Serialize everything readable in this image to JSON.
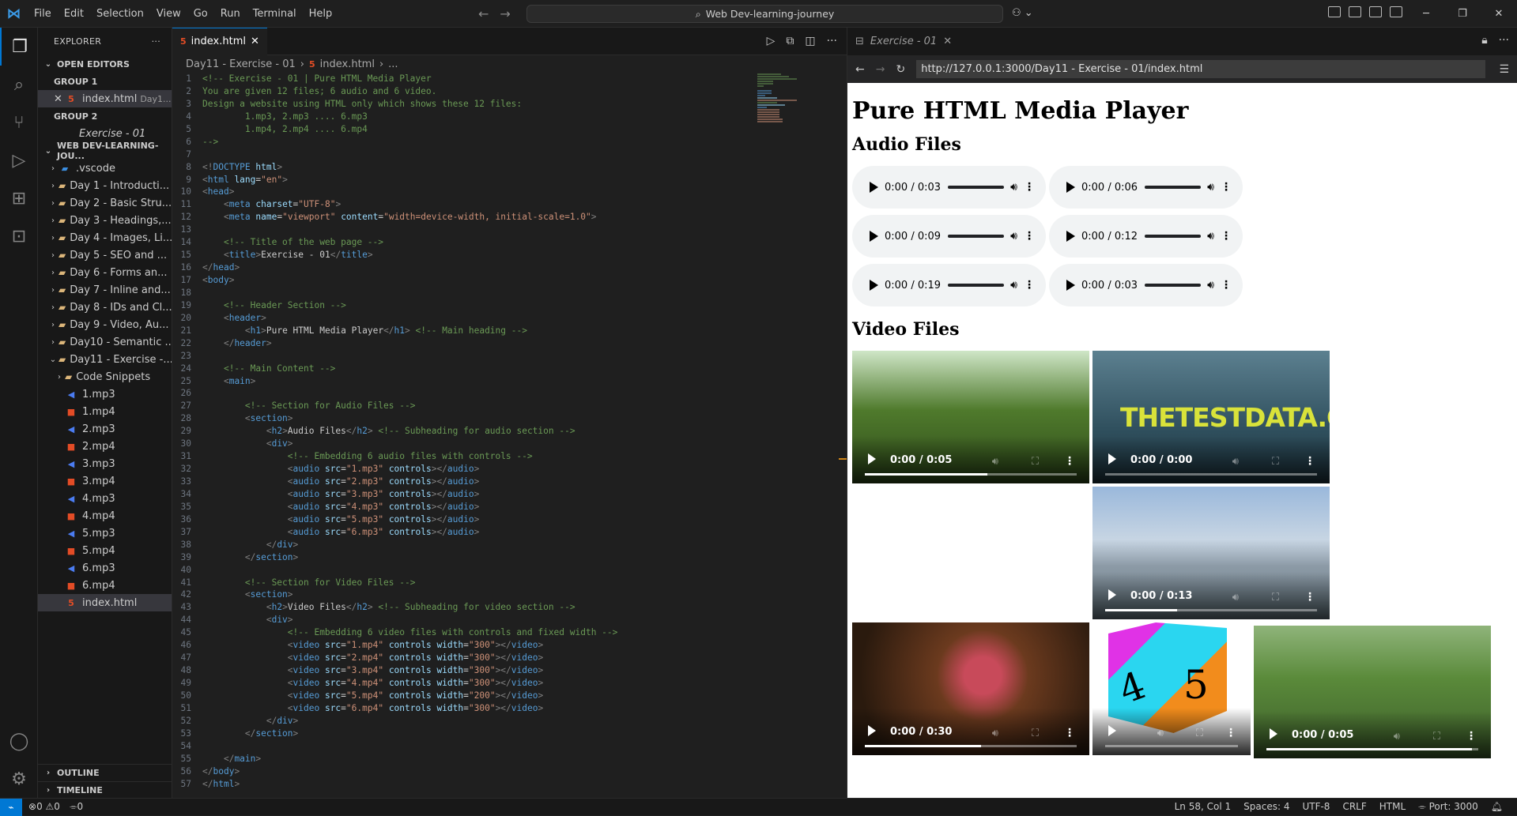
{
  "menu": [
    "File",
    "Edit",
    "Selection",
    "View",
    "Go",
    "Run",
    "Terminal",
    "Help"
  ],
  "command_center": "Web Dev-learning-journey",
  "sidebar": {
    "title": "EXPLORER",
    "open_editors": "OPEN EDITORS",
    "group1": "GROUP 1",
    "group1_file": "index.html",
    "group1_desc": "Day1...",
    "group2": "GROUP 2",
    "group2_file": "Exercise - 01",
    "workspace": "WEB DEV-LEARNING-JOU...",
    "folders": [
      ".vscode",
      "Day 1 - Introducti...",
      "Day 2 - Basic Stru...",
      "Day 3 - Headings,...",
      "Day 4 - Images, Li...",
      "Day 5 - SEO and ...",
      "Day 6 - Forms an...",
      "Day 7 - Inline and...",
      "Day 8 - IDs and Cl...",
      "Day 9 - Video, Au...",
      "Day10 - Semantic ...",
      "Day11 - Exercise -..."
    ],
    "subfolder": "Code Snippets",
    "files": [
      "1.mp3",
      "1.mp4",
      "2.mp3",
      "2.mp4",
      "3.mp3",
      "3.mp4",
      "4.mp3",
      "4.mp4",
      "5.mp3",
      "5.mp4",
      "6.mp3",
      "6.mp4",
      "index.html"
    ],
    "outline": "OUTLINE",
    "timeline": "TIMELINE"
  },
  "editor": {
    "tab": "index.html",
    "crumb1": "Day11 - Exercise - 01",
    "crumb2": "index.html",
    "crumb3": "..."
  },
  "browser": {
    "tab": "Exercise - 01",
    "url": "http://127.0.0.1:3000/Day11 - Exercise - 01/index.html",
    "h1": "Pure HTML Media Player",
    "audio_heading": "Audio Files",
    "video_heading": "Video Files",
    "audios": [
      {
        "time": "0:00 / 0:03"
      },
      {
        "time": "0:00 / 0:06"
      },
      {
        "time": "0:00 / 0:09"
      },
      {
        "time": "0:00 / 0:12"
      },
      {
        "time": "0:00 / 0:19"
      },
      {
        "time": "0:00 / 0:03"
      }
    ],
    "videos": [
      {
        "time": "0:00 / 0:05"
      },
      {
        "time": "0:00 / 0:00",
        "watermark": "THETESTDATA.COM"
      },
      {
        "time": "0:00 / 0:13"
      },
      {
        "time": "0:00 / 0:30"
      },
      {
        "time": ""
      },
      {
        "time": "0:00 / 0:05"
      }
    ]
  },
  "status": {
    "errors": "0",
    "warnings": "0",
    "ports_count": "0",
    "position": "Ln 58, Col 1",
    "spaces": "Spaces: 4",
    "encoding": "UTF-8",
    "eol": "CRLF",
    "language": "HTML",
    "port": "Port: 3000"
  },
  "code_lines": [
    [
      [
        "c",
        "<!-- Exercise - 01 | Pure HTML Media Player"
      ]
    ],
    [
      [
        "c",
        "You are given 12 files; 6 audio and 6 video."
      ]
    ],
    [
      [
        "c",
        "Design a website using HTML only which shows these 12 files:"
      ]
    ],
    [
      [
        "c",
        "        1.mp3, 2.mp3 .... 6.mp3"
      ]
    ],
    [
      [
        "c",
        "        1.mp4, 2.mp4 .... 6.mp4"
      ]
    ],
    [
      [
        "c",
        "-->"
      ]
    ],
    [],
    [
      [
        "p",
        "<!"
      ],
      [
        "t",
        "DOCTYPE"
      ],
      [
        "a",
        " html"
      ],
      [
        "p",
        ">"
      ]
    ],
    [
      [
        "p",
        "<"
      ],
      [
        "t",
        "html"
      ],
      [
        "a",
        " lang"
      ],
      [
        "ltxt",
        "="
      ],
      [
        "s",
        "\"en\""
      ],
      [
        "p",
        ">"
      ]
    ],
    [
      [
        "p",
        "<"
      ],
      [
        "t",
        "head"
      ],
      [
        "p",
        ">"
      ]
    ],
    [
      [
        "ltxt",
        "    "
      ],
      [
        "p",
        "<"
      ],
      [
        "t",
        "meta"
      ],
      [
        "a",
        " charset"
      ],
      [
        "ltxt",
        "="
      ],
      [
        "s",
        "\"UTF-8\""
      ],
      [
        "p",
        ">"
      ]
    ],
    [
      [
        "ltxt",
        "    "
      ],
      [
        "p",
        "<"
      ],
      [
        "t",
        "meta"
      ],
      [
        "a",
        " name"
      ],
      [
        "ltxt",
        "="
      ],
      [
        "s",
        "\"viewport\""
      ],
      [
        "a",
        " content"
      ],
      [
        "ltxt",
        "="
      ],
      [
        "s",
        "\"width=device-width, initial-scale=1.0\""
      ],
      [
        "p",
        ">"
      ]
    ],
    [],
    [
      [
        "ltxt",
        "    "
      ],
      [
        "c",
        "<!-- Title of the web page -->"
      ]
    ],
    [
      [
        "ltxt",
        "    "
      ],
      [
        "p",
        "<"
      ],
      [
        "t",
        "title"
      ],
      [
        "p",
        ">"
      ],
      [
        "ltxt",
        "Exercise - 01"
      ],
      [
        "p",
        "</"
      ],
      [
        "t",
        "title"
      ],
      [
        "p",
        ">"
      ]
    ],
    [
      [
        "p",
        "</"
      ],
      [
        "t",
        "head"
      ],
      [
        "p",
        ">"
      ]
    ],
    [
      [
        "p",
        "<"
      ],
      [
        "t",
        "body"
      ],
      [
        "p",
        ">"
      ]
    ],
    [],
    [
      [
        "ltxt",
        "    "
      ],
      [
        "c",
        "<!-- Header Section -->"
      ]
    ],
    [
      [
        "ltxt",
        "    "
      ],
      [
        "p",
        "<"
      ],
      [
        "t",
        "header"
      ],
      [
        "p",
        ">"
      ]
    ],
    [
      [
        "ltxt",
        "        "
      ],
      [
        "p",
        "<"
      ],
      [
        "t",
        "h1"
      ],
      [
        "p",
        ">"
      ],
      [
        "ltxt",
        "Pure HTML Media Player"
      ],
      [
        "p",
        "</"
      ],
      [
        "t",
        "h1"
      ],
      [
        "p",
        "> "
      ],
      [
        "c",
        "<!-- Main heading -->"
      ]
    ],
    [
      [
        "ltxt",
        "    "
      ],
      [
        "p",
        "</"
      ],
      [
        "t",
        "header"
      ],
      [
        "p",
        ">"
      ]
    ],
    [],
    [
      [
        "ltxt",
        "    "
      ],
      [
        "c",
        "<!-- Main Content -->"
      ]
    ],
    [
      [
        "ltxt",
        "    "
      ],
      [
        "p",
        "<"
      ],
      [
        "t",
        "main"
      ],
      [
        "p",
        ">"
      ]
    ],
    [],
    [
      [
        "ltxt",
        "        "
      ],
      [
        "c",
        "<!-- Section for Audio Files -->"
      ]
    ],
    [
      [
        "ltxt",
        "        "
      ],
      [
        "p",
        "<"
      ],
      [
        "t",
        "section"
      ],
      [
        "p",
        ">"
      ]
    ],
    [
      [
        "ltxt",
        "            "
      ],
      [
        "p",
        "<"
      ],
      [
        "t",
        "h2"
      ],
      [
        "p",
        ">"
      ],
      [
        "ltxt",
        "Audio Files"
      ],
      [
        "p",
        "</"
      ],
      [
        "t",
        "h2"
      ],
      [
        "p",
        "> "
      ],
      [
        "c",
        "<!-- Subheading for audio section -->"
      ]
    ],
    [
      [
        "ltxt",
        "            "
      ],
      [
        "p",
        "<"
      ],
      [
        "t",
        "div"
      ],
      [
        "p",
        ">"
      ]
    ],
    [
      [
        "ltxt",
        "                "
      ],
      [
        "c",
        "<!-- Embedding 6 audio files with controls -->"
      ]
    ],
    [
      [
        "ltxt",
        "                "
      ],
      [
        "p",
        "<"
      ],
      [
        "t",
        "audio"
      ],
      [
        "a",
        " src"
      ],
      [
        "ltxt",
        "="
      ],
      [
        "s",
        "\"1.mp3\""
      ],
      [
        "a",
        " controls"
      ],
      [
        "p",
        "></"
      ],
      [
        "t",
        "audio"
      ],
      [
        "p",
        ">"
      ]
    ],
    [
      [
        "ltxt",
        "                "
      ],
      [
        "p",
        "<"
      ],
      [
        "t",
        "audio"
      ],
      [
        "a",
        " src"
      ],
      [
        "ltxt",
        "="
      ],
      [
        "s",
        "\"2.mp3\""
      ],
      [
        "a",
        " controls"
      ],
      [
        "p",
        "></"
      ],
      [
        "t",
        "audio"
      ],
      [
        "p",
        ">"
      ]
    ],
    [
      [
        "ltxt",
        "                "
      ],
      [
        "p",
        "<"
      ],
      [
        "t",
        "audio"
      ],
      [
        "a",
        " src"
      ],
      [
        "ltxt",
        "="
      ],
      [
        "s",
        "\"3.mp3\""
      ],
      [
        "a",
        " controls"
      ],
      [
        "p",
        "></"
      ],
      [
        "t",
        "audio"
      ],
      [
        "p",
        ">"
      ]
    ],
    [
      [
        "ltxt",
        "                "
      ],
      [
        "p",
        "<"
      ],
      [
        "t",
        "audio"
      ],
      [
        "a",
        " src"
      ],
      [
        "ltxt",
        "="
      ],
      [
        "s",
        "\"4.mp3\""
      ],
      [
        "a",
        " controls"
      ],
      [
        "p",
        "></"
      ],
      [
        "t",
        "audio"
      ],
      [
        "p",
        ">"
      ]
    ],
    [
      [
        "ltxt",
        "                "
      ],
      [
        "p",
        "<"
      ],
      [
        "t",
        "audio"
      ],
      [
        "a",
        " src"
      ],
      [
        "ltxt",
        "="
      ],
      [
        "s",
        "\"5.mp3\""
      ],
      [
        "a",
        " controls"
      ],
      [
        "p",
        "></"
      ],
      [
        "t",
        "audio"
      ],
      [
        "p",
        ">"
      ]
    ],
    [
      [
        "ltxt",
        "                "
      ],
      [
        "p",
        "<"
      ],
      [
        "t",
        "audio"
      ],
      [
        "a",
        " src"
      ],
      [
        "ltxt",
        "="
      ],
      [
        "s",
        "\"6.mp3\""
      ],
      [
        "a",
        " controls"
      ],
      [
        "p",
        "></"
      ],
      [
        "t",
        "audio"
      ],
      [
        "p",
        ">"
      ]
    ],
    [
      [
        "ltxt",
        "            "
      ],
      [
        "p",
        "</"
      ],
      [
        "t",
        "div"
      ],
      [
        "p",
        ">"
      ]
    ],
    [
      [
        "ltxt",
        "        "
      ],
      [
        "p",
        "</"
      ],
      [
        "t",
        "section"
      ],
      [
        "p",
        ">"
      ]
    ],
    [],
    [
      [
        "ltxt",
        "        "
      ],
      [
        "c",
        "<!-- Section for Video Files -->"
      ]
    ],
    [
      [
        "ltxt",
        "        "
      ],
      [
        "p",
        "<"
      ],
      [
        "t",
        "section"
      ],
      [
        "p",
        ">"
      ]
    ],
    [
      [
        "ltxt",
        "            "
      ],
      [
        "p",
        "<"
      ],
      [
        "t",
        "h2"
      ],
      [
        "p",
        ">"
      ],
      [
        "ltxt",
        "Video Files"
      ],
      [
        "p",
        "</"
      ],
      [
        "t",
        "h2"
      ],
      [
        "p",
        "> "
      ],
      [
        "c",
        "<!-- Subheading for video section -->"
      ]
    ],
    [
      [
        "ltxt",
        "            "
      ],
      [
        "p",
        "<"
      ],
      [
        "t",
        "div"
      ],
      [
        "p",
        ">"
      ]
    ],
    [
      [
        "ltxt",
        "                "
      ],
      [
        "c",
        "<!-- Embedding 6 video files with controls and fixed width -->"
      ]
    ],
    [
      [
        "ltxt",
        "                "
      ],
      [
        "p",
        "<"
      ],
      [
        "t",
        "video"
      ],
      [
        "a",
        " src"
      ],
      [
        "ltxt",
        "="
      ],
      [
        "s",
        "\"1.mp4\""
      ],
      [
        "a",
        " controls"
      ],
      [
        "a",
        " width"
      ],
      [
        "ltxt",
        "="
      ],
      [
        "s",
        "\"300\""
      ],
      [
        "p",
        "></"
      ],
      [
        "t",
        "video"
      ],
      [
        "p",
        ">"
      ]
    ],
    [
      [
        "ltxt",
        "                "
      ],
      [
        "p",
        "<"
      ],
      [
        "t",
        "video"
      ],
      [
        "a",
        " src"
      ],
      [
        "ltxt",
        "="
      ],
      [
        "s",
        "\"2.mp4\""
      ],
      [
        "a",
        " controls"
      ],
      [
        "a",
        " width"
      ],
      [
        "ltxt",
        "="
      ],
      [
        "s",
        "\"300\""
      ],
      [
        "p",
        "></"
      ],
      [
        "t",
        "video"
      ],
      [
        "p",
        ">"
      ]
    ],
    [
      [
        "ltxt",
        "                "
      ],
      [
        "p",
        "<"
      ],
      [
        "t",
        "video"
      ],
      [
        "a",
        " src"
      ],
      [
        "ltxt",
        "="
      ],
      [
        "s",
        "\"3.mp4\""
      ],
      [
        "a",
        " controls"
      ],
      [
        "a",
        " width"
      ],
      [
        "ltxt",
        "="
      ],
      [
        "s",
        "\"300\""
      ],
      [
        "p",
        "></"
      ],
      [
        "t",
        "video"
      ],
      [
        "p",
        ">"
      ]
    ],
    [
      [
        "ltxt",
        "                "
      ],
      [
        "p",
        "<"
      ],
      [
        "t",
        "video"
      ],
      [
        "a",
        " src"
      ],
      [
        "ltxt",
        "="
      ],
      [
        "s",
        "\"4.mp4\""
      ],
      [
        "a",
        " controls"
      ],
      [
        "a",
        " width"
      ],
      [
        "ltxt",
        "="
      ],
      [
        "s",
        "\"300\""
      ],
      [
        "p",
        "></"
      ],
      [
        "t",
        "video"
      ],
      [
        "p",
        ">"
      ]
    ],
    [
      [
        "ltxt",
        "                "
      ],
      [
        "p",
        "<"
      ],
      [
        "t",
        "video"
      ],
      [
        "a",
        " src"
      ],
      [
        "ltxt",
        "="
      ],
      [
        "s",
        "\"5.mp4\""
      ],
      [
        "a",
        " controls"
      ],
      [
        "a",
        " width"
      ],
      [
        "ltxt",
        "="
      ],
      [
        "s",
        "\"200\""
      ],
      [
        "p",
        "></"
      ],
      [
        "t",
        "video"
      ],
      [
        "p",
        ">"
      ]
    ],
    [
      [
        "ltxt",
        "                "
      ],
      [
        "p",
        "<"
      ],
      [
        "t",
        "video"
      ],
      [
        "a",
        " src"
      ],
      [
        "ltxt",
        "="
      ],
      [
        "s",
        "\"6.mp4\""
      ],
      [
        "a",
        " controls"
      ],
      [
        "a",
        " width"
      ],
      [
        "ltxt",
        "="
      ],
      [
        "s",
        "\"300\""
      ],
      [
        "p",
        "></"
      ],
      [
        "t",
        "video"
      ],
      [
        "p",
        ">"
      ]
    ],
    [
      [
        "ltxt",
        "            "
      ],
      [
        "p",
        "</"
      ],
      [
        "t",
        "div"
      ],
      [
        "p",
        ">"
      ]
    ],
    [
      [
        "ltxt",
        "        "
      ],
      [
        "p",
        "</"
      ],
      [
        "t",
        "section"
      ],
      [
        "p",
        ">"
      ]
    ],
    [],
    [
      [
        "ltxt",
        "    "
      ],
      [
        "p",
        "</"
      ],
      [
        "t",
        "main"
      ],
      [
        "p",
        ">"
      ]
    ],
    [
      [
        "p",
        "</"
      ],
      [
        "t",
        "body"
      ],
      [
        "p",
        ">"
      ]
    ],
    [
      [
        "p",
        "</"
      ],
      [
        "t",
        "html"
      ],
      [
        "p",
        ">"
      ]
    ]
  ]
}
